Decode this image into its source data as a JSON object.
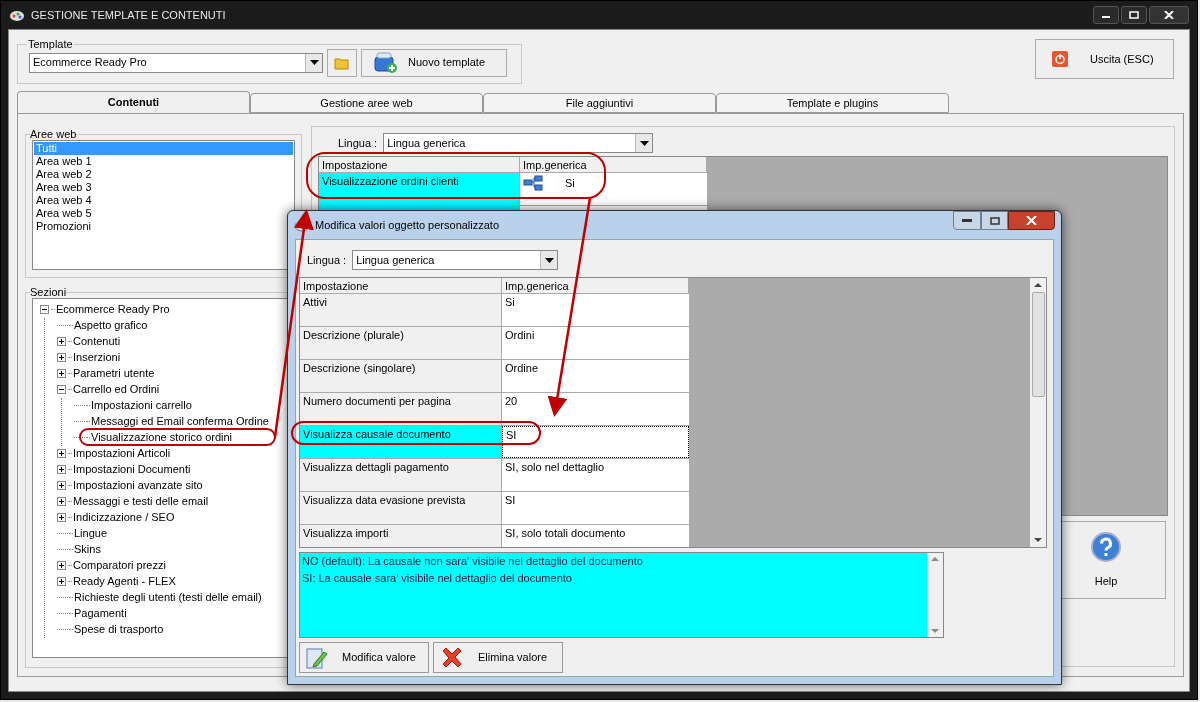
{
  "window": {
    "title": "GESTIONE TEMPLATE E CONTENUTI"
  },
  "template": {
    "label": "Template",
    "value": "Ecommerce Ready Pro",
    "new_button": "Nuovo template"
  },
  "exit_button": "Uscita (ESC)",
  "tabs": [
    {
      "label": "Contenuti",
      "selected": true
    },
    {
      "label": "Gestione aree web",
      "selected": false
    },
    {
      "label": "File aggiuntivi",
      "selected": false
    },
    {
      "label": "Template e plugins",
      "selected": false
    }
  ],
  "web_areas": {
    "label": "Aree web",
    "items": [
      {
        "label": "Tutti",
        "selected": true
      },
      {
        "label": "Area web 1",
        "selected": false
      },
      {
        "label": "Area web 2",
        "selected": false
      },
      {
        "label": "Area web 3",
        "selected": false
      },
      {
        "label": "Area web 4",
        "selected": false
      },
      {
        "label": "Area web 5",
        "selected": false
      },
      {
        "label": "Promozioni",
        "selected": false
      }
    ]
  },
  "sections": {
    "label": "Sezioni",
    "tree": [
      {
        "label": "Ecommerce Ready Pro",
        "expanded": true,
        "children": [
          {
            "label": "Aspetto grafico"
          },
          {
            "label": "Contenuti",
            "expanded": false
          },
          {
            "label": "Inserzioni",
            "expanded": false
          },
          {
            "label": "Parametri utente",
            "expanded": false
          },
          {
            "label": "Carrello ed Ordini",
            "expanded": true,
            "children": [
              {
                "label": "Impostazioni carrello"
              },
              {
                "label": "Messaggi ed Email conferma Ordine"
              },
              {
                "label": "Visualizzazione storico ordini"
              }
            ]
          },
          {
            "label": "Impostazioni Articoli",
            "expanded": false
          },
          {
            "label": "Impostazioni Documenti",
            "expanded": false
          },
          {
            "label": "Impostazioni avanzate sito",
            "expanded": false
          },
          {
            "label": "Messaggi e testi delle email",
            "expanded": false
          },
          {
            "label": "Indicizzazione / SEO",
            "expanded": false
          },
          {
            "label": "Lingue"
          },
          {
            "label": "Skins"
          },
          {
            "label": "Comparatori prezzi",
            "expanded": false
          },
          {
            "label": "Ready Agenti - FLEX",
            "expanded": false
          },
          {
            "label": "Richieste degli utenti (testi delle email)"
          },
          {
            "label": "Pagamenti"
          },
          {
            "label": "Spese di trasporto"
          }
        ]
      }
    ]
  },
  "settings": {
    "language_label": "Lingua :",
    "language": "Lingua generica",
    "columns": [
      "Impostazione",
      "Imp.generica"
    ],
    "rows": [
      {
        "setting": "Visualizzazione ordini clienti",
        "value": "Si",
        "selected": true
      }
    ]
  },
  "help_button": "Help",
  "dialog": {
    "title": "Modifica valori oggetto personalizzato",
    "language_label": "Lingua :",
    "language": "Lingua generica",
    "columns": [
      "Impostazione",
      "Imp.generica"
    ],
    "rows": [
      {
        "setting": "Attivi",
        "value": "Si",
        "selected": false
      },
      {
        "setting": "Descrizione (plurale)",
        "value": "Ordini",
        "selected": false
      },
      {
        "setting": "Descrizione (singolare)",
        "value": "Ordine",
        "selected": false
      },
      {
        "setting": "Numero documenti per pagina",
        "value": "20",
        "selected": false
      },
      {
        "setting": "Visualizza causale documento",
        "value": "SI",
        "selected": true
      },
      {
        "setting": "Visualizza dettagli pagamento",
        "value": "SI, solo nel dettaglio",
        "selected": false
      },
      {
        "setting": "Visualizza data evasione prevista",
        "value": "SI",
        "selected": false
      },
      {
        "setting": "Visualizza importi",
        "value": "SI, solo totali documento",
        "selected": false
      }
    ],
    "description": [
      "NO (default): La causale non sara' visibile nel dettaglio del documento",
      "SI: La causale sara' visibile nel dettaglio del documento"
    ],
    "buttons": [
      {
        "label": "Modifica valore",
        "kind": "edit"
      },
      {
        "label": "Elimina valore",
        "kind": "delete"
      }
    ]
  }
}
